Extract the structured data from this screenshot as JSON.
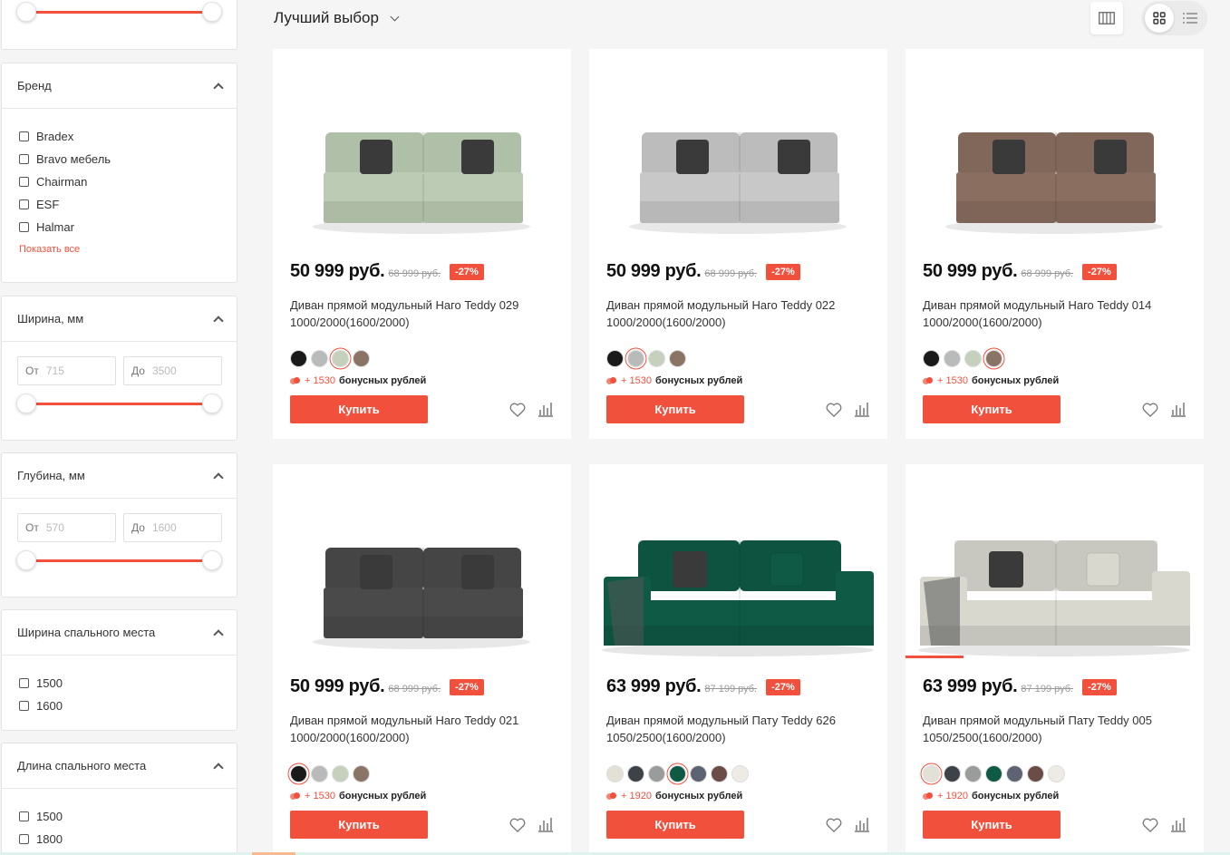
{
  "sort": {
    "label": "Лучший выбор"
  },
  "filters": {
    "brand": {
      "title": "Бренд",
      "items": [
        "Bradex",
        "Bravo мебель",
        "Chairman",
        "ESF",
        "Halmar"
      ],
      "show_all": "Показать все"
    },
    "width": {
      "title": "Ширина, мм",
      "from_label": "От",
      "from_value": "715",
      "to_label": "До",
      "to_value": "3500"
    },
    "depth": {
      "title": "Глубина, мм",
      "from_label": "От",
      "from_value": "570",
      "to_label": "До",
      "to_value": "1600"
    },
    "sleep_width": {
      "title": "Ширина спального места",
      "items": [
        "1500",
        "1600"
      ]
    },
    "sleep_length": {
      "title": "Длина спального места",
      "items": [
        "1500",
        "1800"
      ]
    }
  },
  "buy_label": "Купить",
  "bonus_suffix": "бонусных рублей",
  "products": [
    {
      "price": "50 999 руб.",
      "old_price": "68 999 руб.",
      "discount": "-27%",
      "title": "Диван прямой модульный Наго Teddy 029 1000/2000(1600/2000)",
      "bonus": "+ 1530",
      "sofa_color": "#bccbb3",
      "swatches": [
        "#1a1a1a",
        "#b9bbba",
        "#c6d1bd",
        "#8a7466"
      ],
      "selected_swatch": 2
    },
    {
      "price": "50 999 руб.",
      "old_price": "68 999 руб.",
      "discount": "-27%",
      "title": "Диван прямой модульный Наго Teddy 022 1000/2000(1600/2000)",
      "bonus": "+ 1530",
      "sofa_color": "#c7c8c7",
      "swatches": [
        "#1a1a1a",
        "#b9bbba",
        "#c6d1bd",
        "#8a7466"
      ],
      "selected_swatch": 1
    },
    {
      "price": "50 999 руб.",
      "old_price": "68 999 руб.",
      "discount": "-27%",
      "title": "Диван прямой модульный Наго Teddy 014 1000/2000(1600/2000)",
      "bonus": "+ 1530",
      "sofa_color": "#8a6e60",
      "swatches": [
        "#1a1a1a",
        "#b9bbba",
        "#c6d1bd",
        "#8a7466"
      ],
      "selected_swatch": 3
    },
    {
      "price": "50 999 руб.",
      "old_price": "68 999 руб.",
      "discount": "-27%",
      "title": "Диван прямой модульный Наго Teddy 021 1000/2000(1600/2000)",
      "bonus": "+ 1530",
      "sofa_color": "#4a4a4a",
      "swatches": [
        "#1a1a1a",
        "#b9bbba",
        "#c6d1bd",
        "#8a7466"
      ],
      "selected_swatch": 0
    },
    {
      "price": "63 999 руб.",
      "old_price": "87 199 руб.",
      "discount": "-27%",
      "title": "Диван прямой модульный Пату Teddy 626 1050/2500(1600/2000)",
      "bonus": "+ 1920",
      "sofa_color": "#0f5a45",
      "swatches": [
        "#e3e1d6",
        "#3d4248",
        "#9a9c9b",
        "#0f5a45",
        "#5d6372",
        "#6b4c46",
        "#eeebe5"
      ],
      "selected_swatch": 3
    },
    {
      "price": "63 999 руб.",
      "old_price": "87 199 руб.",
      "discount": "-27%",
      "title": "Диван прямой модульный Пату Teddy 005 1050/2500(1600/2000)",
      "bonus": "+ 1920",
      "sofa_color": "#d8d8cf",
      "swatches": [
        "#e3e1d6",
        "#3d4248",
        "#9a9c9b",
        "#0f5a45",
        "#5d6372",
        "#6b4c46",
        "#eeebe5"
      ],
      "selected_swatch": 0
    }
  ],
  "colors": {
    "accent": "#f0503c"
  },
  "icons": [
    "chevron-up-icon",
    "chevron-down-icon",
    "columns-view-icon",
    "grid-view-icon",
    "list-view-icon",
    "heart-icon",
    "compare-icon",
    "coins-icon"
  ]
}
